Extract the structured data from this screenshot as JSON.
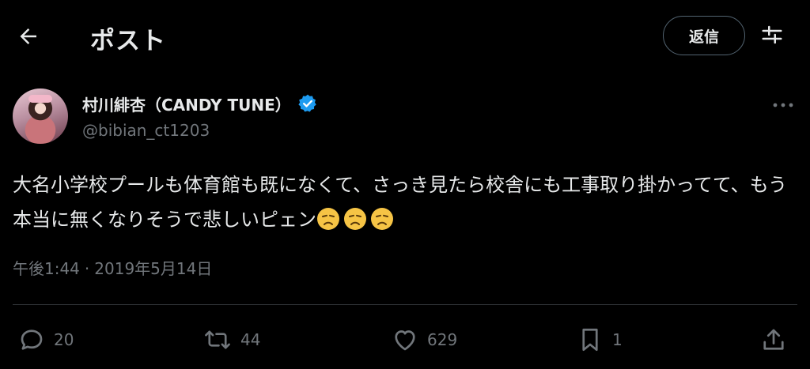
{
  "header": {
    "title": "ポスト",
    "reply_label": "返信",
    "icons": {
      "back": "arrow-left-icon",
      "settings": "sliders-icon"
    }
  },
  "post": {
    "author": {
      "display_name": "村川緋杏（CANDY TUNE）",
      "handle": "@bibian_ct1203",
      "verified": true,
      "verified_color": "#1d9bf0"
    },
    "text": "大名小学校プールも体育館も既になくて、さっき見たら校舎にも工事取り掛かってて、もう本当に無くなりそうで悲しいピェン",
    "emoji": [
      "disappointed-face-emoji",
      "disappointed-face-emoji",
      "disappointed-face-emoji"
    ],
    "time": "午後1:44",
    "separator": "·",
    "date": "2019年5月14日"
  },
  "actions": {
    "replies": "20",
    "reposts": "44",
    "likes": "629",
    "bookmarks": "1"
  },
  "colors": {
    "background": "#000000",
    "text_primary": "#e7e9ea",
    "text_secondary": "#71767b",
    "divider": "#2f3336",
    "accent": "#1d9bf0"
  }
}
